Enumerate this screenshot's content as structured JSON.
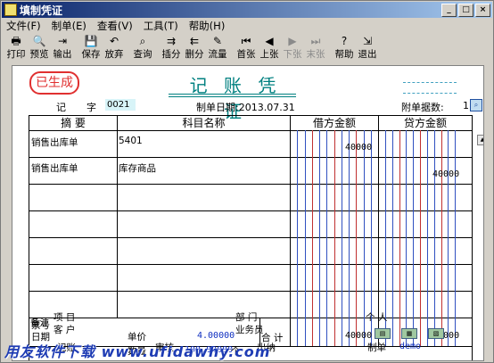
{
  "window": {
    "title": "填制凭证"
  },
  "menu": [
    "文件(F)",
    "制单(E)",
    "查看(V)",
    "工具(T)",
    "帮助(H)"
  ],
  "toolbar": [
    {
      "label": "打印",
      "icon": "printer-icon",
      "glyph": "🖶",
      "enabled": true
    },
    {
      "label": "预览",
      "icon": "preview-icon",
      "glyph": "🔍",
      "enabled": true
    },
    {
      "label": "输出",
      "icon": "export-icon",
      "glyph": "⇥",
      "enabled": true
    },
    {
      "label": "保存",
      "icon": "save-icon",
      "glyph": "💾",
      "enabled": true
    },
    {
      "label": "放弃",
      "icon": "undo-icon",
      "glyph": "↶",
      "enabled": true
    },
    {
      "label": "查询",
      "icon": "binoculars-icon",
      "glyph": "⌕",
      "enabled": true
    },
    {
      "label": "插分",
      "icon": "insert-row-icon",
      "glyph": "⇉",
      "enabled": true
    },
    {
      "label": "删分",
      "icon": "delete-row-icon",
      "glyph": "⇇",
      "enabled": true
    },
    {
      "label": "流量",
      "icon": "cashflow-icon",
      "glyph": "✎",
      "enabled": true
    },
    {
      "label": "首张",
      "icon": "first-icon",
      "glyph": "⏮",
      "enabled": true
    },
    {
      "label": "上张",
      "icon": "previous-icon",
      "glyph": "◀",
      "enabled": true
    },
    {
      "label": "下张",
      "icon": "next-icon",
      "glyph": "▶",
      "enabled": false
    },
    {
      "label": "末张",
      "icon": "last-icon",
      "glyph": "⏭",
      "enabled": false
    },
    {
      "label": "帮助",
      "icon": "help-icon",
      "glyph": "?",
      "enabled": true
    },
    {
      "label": "退出",
      "icon": "exit-icon",
      "glyph": "⇲",
      "enabled": true
    }
  ],
  "voucher": {
    "stamp": "已生成",
    "heading": "记 账 凭 证",
    "type_label": "记",
    "no_label": "字",
    "no_value": "0021",
    "date_text": "制单日期:2013.07.31",
    "attach_label": "附单据数:",
    "attach_value": "1",
    "columns": [
      "摘  要",
      "科目名称",
      "借方金额",
      "贷方金额"
    ],
    "rows": [
      {
        "summary": "销售出库单",
        "account": "5401",
        "debit": "40000",
        "credit": ""
      },
      {
        "summary": "销售出库单",
        "account": "库存商品",
        "debit": "",
        "credit": "40000"
      }
    ],
    "ticket_label": "票号",
    "date_label": "日期",
    "price_label": "单价",
    "price_value": "4.00000",
    "qty_label": "数量",
    "qty_value": "100.00000",
    "qty_unit": "个",
    "total_label": "合 计",
    "total_debit": "40000",
    "total_credit": "40000",
    "remark_label": "备注",
    "project_label": "项  目",
    "dept_label": "部  门",
    "person_label": "个  人",
    "customer_label": "客  户",
    "salesman_label": "业务员",
    "bookkeeper_label": "记账",
    "review_label": "审核",
    "cashier_label": "出纳",
    "maker_label": "制单",
    "maker_value": "demo"
  },
  "watermark": "用友软件下载  www.ufidawhy.com"
}
